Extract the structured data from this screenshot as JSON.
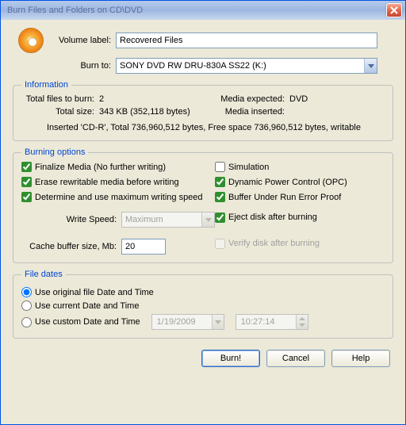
{
  "window": {
    "title": "Burn Files and Folders on CD\\DVD"
  },
  "form": {
    "volume_label_label": "Volume label:",
    "volume_label_value": "Recovered Files",
    "burn_to_label": "Burn to:",
    "burn_to_value": "SONY    DVD RW DRU-830A  SS22  (K:)"
  },
  "info": {
    "legend": "Information",
    "files_label": "Total files to burn:",
    "files_value": "2",
    "size_label": "Total size:",
    "size_value": "343 KB (352,118 bytes)",
    "media_expected_label": "Media expected:",
    "media_expected_value": "DVD",
    "media_inserted_label": "Media inserted:",
    "media_inserted_value": "",
    "inserted_line": "Inserted 'CD-R', Total 736,960,512 bytes, Free space 736,960,512 bytes, writable"
  },
  "burn": {
    "legend": "Burning options",
    "finalize": "Finalize Media (No further writing)",
    "erase": "Erase rewritable media before writing",
    "determine": "Determine and use maximum writing speed",
    "simulation": "Simulation",
    "dpc": "Dynamic Power Control (OPC)",
    "buffer": "Buffer Under Run Error Proof",
    "eject": "Eject disk after burning",
    "verify": "Verify disk after burning",
    "write_speed_label": "Write Speed:",
    "write_speed_value": "Maximum",
    "cache_label": "Cache buffer size, Mb:",
    "cache_value": "20"
  },
  "dates": {
    "legend": "File dates",
    "original": "Use original file Date and Time",
    "current": "Use current Date and Time",
    "custom": "Use custom Date and Time",
    "date_value": "1/19/2009",
    "time_value": "10:27:14"
  },
  "buttons": {
    "burn": "Burn!",
    "cancel": "Cancel",
    "help": "Help"
  }
}
